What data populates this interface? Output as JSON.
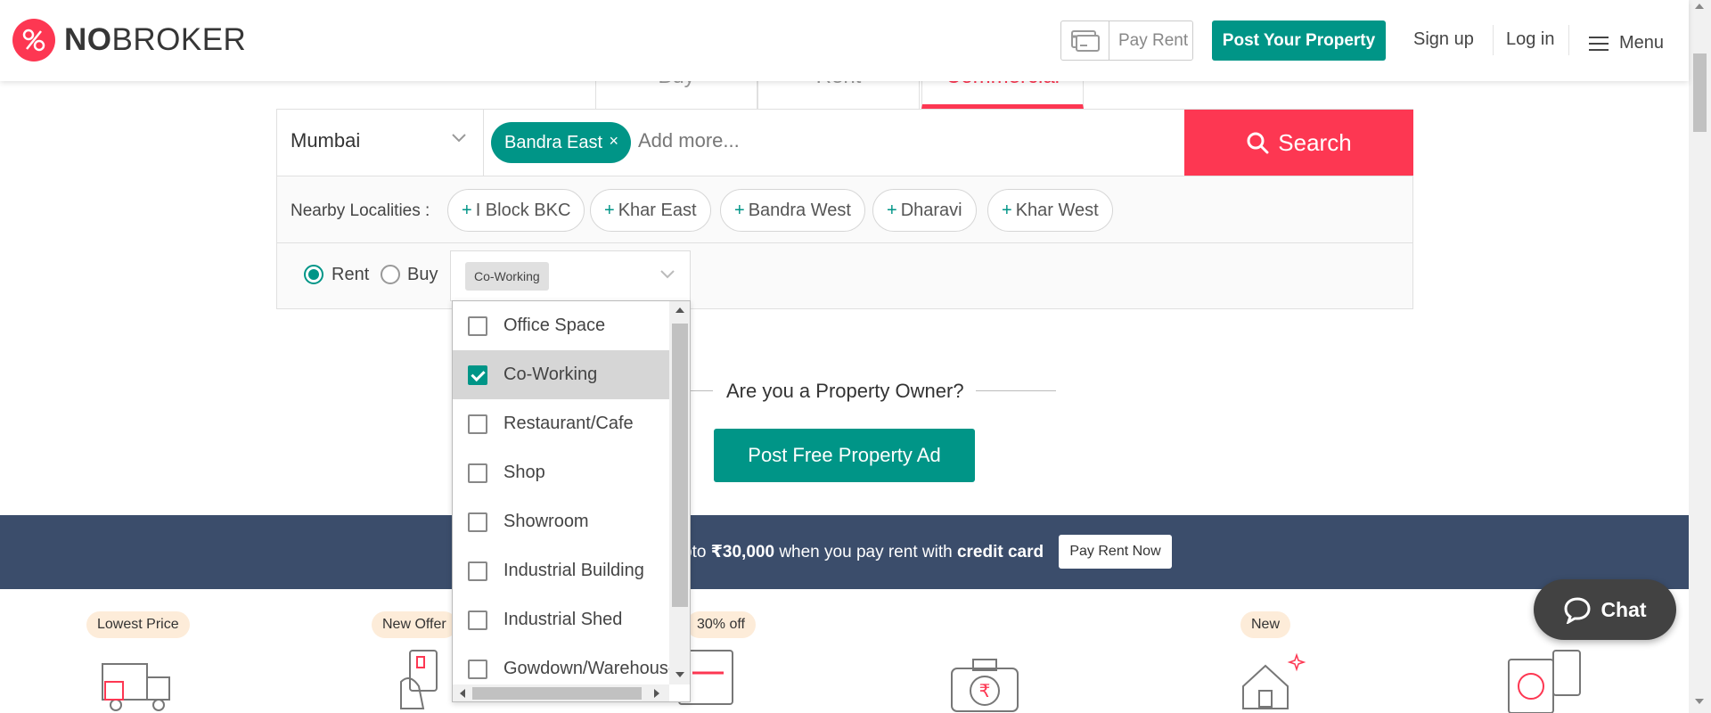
{
  "brand": {
    "logo_bold": "NO",
    "logo_rest": "BROKER",
    "accent": "#fd3752",
    "primary": "#009587"
  },
  "header": {
    "pay_rent": "Pay Rent",
    "post_property": "Post Your Property",
    "sign_up": "Sign up",
    "log_in": "Log in",
    "menu": "Menu"
  },
  "tabs": [
    {
      "label": "Buy",
      "active": false
    },
    {
      "label": "Rent",
      "active": false
    },
    {
      "label": "Commercial",
      "active": true
    }
  ],
  "search": {
    "city": "Mumbai",
    "selected_locality": "Bandra East",
    "remove_icon": "×",
    "placeholder": "Add more...",
    "button": "Search",
    "nearby_label": "Nearby Localities :",
    "nearby": [
      "I Block BKC",
      "Khar East",
      "Bandra West",
      "Dharavi",
      "Khar West"
    ],
    "radio_rent": "Rent",
    "radio_buy": "Buy",
    "selected_rent": true,
    "property_type_tag": "Co-Working"
  },
  "dropdown": {
    "items": [
      {
        "label": "Office Space",
        "checked": false
      },
      {
        "label": "Co-Working",
        "checked": true
      },
      {
        "label": "Restaurant/Cafe",
        "checked": false
      },
      {
        "label": "Shop",
        "checked": false
      },
      {
        "label": "Showroom",
        "checked": false
      },
      {
        "label": "Industrial Building",
        "checked": false
      },
      {
        "label": "Industrial Shed",
        "checked": false
      },
      {
        "label": "Gowdown/Warehouse",
        "checked": false
      }
    ]
  },
  "owner": {
    "question": "Are you a Property Owner?",
    "button": "Post Free Property Ad"
  },
  "banner": {
    "text_prefix": "pto ",
    "amount": "₹30,000",
    "text_mid": " when you pay rent with ",
    "emphasis": "credit card",
    "button": "Pay Rent Now"
  },
  "services": {
    "badges": [
      "Lowest Price",
      "New Offer",
      "30% off",
      "New"
    ]
  },
  "chat": {
    "label": "Chat"
  }
}
